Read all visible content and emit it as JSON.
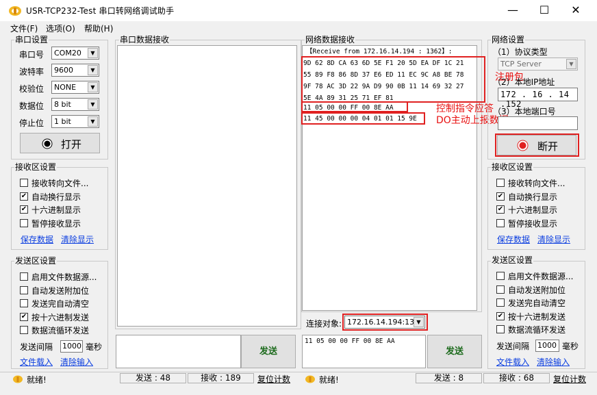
{
  "window": {
    "title": "USR-TCP232-Test 串口转网络调试助手",
    "min": "—",
    "max": "☐",
    "close": "✕"
  },
  "menu": [
    "文件(F)",
    "选项(O)",
    "帮助(H)"
  ],
  "serial_settings": {
    "title": "串口设置",
    "fields": [
      {
        "label": "串口号",
        "value": "COM20"
      },
      {
        "label": "波特率",
        "value": "9600"
      },
      {
        "label": "校验位",
        "value": "NONE"
      },
      {
        "label": "数据位",
        "value": "8 bit"
      },
      {
        "label": "停止位",
        "value": "1 bit"
      }
    ],
    "open_button": "打开"
  },
  "left_recv": {
    "title": "接收区设置",
    "options": [
      {
        "label": "接收转向文件...",
        "checked": false
      },
      {
        "label": "自动换行显示",
        "checked": true
      },
      {
        "label": "十六进制显示",
        "checked": true
      },
      {
        "label": "暂停接收显示",
        "checked": false
      }
    ],
    "save": "保存数据",
    "clear": "清除显示"
  },
  "left_send": {
    "title": "发送区设置",
    "options": [
      {
        "label": "启用文件数据源...",
        "checked": false
      },
      {
        "label": "自动发送附加位",
        "checked": false
      },
      {
        "label": "发送完自动清空",
        "checked": false
      },
      {
        "label": "按十六进制发送",
        "checked": true
      },
      {
        "label": "数据流循环发送",
        "checked": false
      }
    ],
    "interval_label": "发送间隔",
    "interval_value": "1000",
    "interval_unit": "毫秒",
    "load": "文件载入",
    "clear": "清除输入"
  },
  "serial_recv": {
    "title": "串口数据接收"
  },
  "serial_send": {
    "button": "发送"
  },
  "net_recv": {
    "title": "网络数据接收",
    "lines": [
      "【Receive from 172.16.14.194 : 1362】:",
      "9D 62 8D CA 63 6D 5E F1 20 5D EA DF 1C 21",
      "55 89 F8 86 8D 37 E6 ED 11 EC 9C A8 BE 78",
      "9F 78 AC 3D 22 9A D9 90 0B 11 14 69 32 27",
      "5E 4A 89 31 25 71 EF 81",
      "11 05 00 00 FF 00 8E AA",
      "11 45 00 00 00 04 01 01 15 9E"
    ],
    "annotations": [
      "注册包",
      "控制指令应答",
      "DO主动上报数据"
    ]
  },
  "connect": {
    "label": "连接对象:",
    "value": "172.16.14.194:1362"
  },
  "net_send": {
    "text": "11 05 00 00 FF 00 8E AA",
    "button": "发送"
  },
  "net_settings": {
    "title": "网络设置",
    "proto_label": "（1）协议类型",
    "proto_value": "TCP Server",
    "ip_label": "（2）本地IP地址",
    "ip_value": "172 . 16 . 14 .152",
    "port_label": "（3）本地端口号",
    "disconnect": "断开"
  },
  "right_recv": {
    "title": "接收区设置",
    "options": [
      {
        "label": "接收转向文件...",
        "checked": false
      },
      {
        "label": "自动换行显示",
        "checked": true
      },
      {
        "label": "十六进制显示",
        "checked": true
      },
      {
        "label": "暂停接收显示",
        "checked": false
      }
    ],
    "save": "保存数据",
    "clear": "清除显示"
  },
  "right_send": {
    "title": "发送区设置",
    "options": [
      {
        "label": "启用文件数据源...",
        "checked": false
      },
      {
        "label": "自动发送附加位",
        "checked": false
      },
      {
        "label": "发送完自动清空",
        "checked": false
      },
      {
        "label": "按十六进制发送",
        "checked": true
      },
      {
        "label": "数据流循环发送",
        "checked": false
      }
    ],
    "interval_label": "发送间隔",
    "interval_value": "1000",
    "interval_unit": "毫秒",
    "load": "文件载入",
    "clear": "清除输入"
  },
  "status_left": {
    "ready": "就绪!",
    "sent": "发送 : 48",
    "recv": "接收 : 189",
    "reset": "复位计数"
  },
  "status_right": {
    "ready": "就绪!",
    "sent": "发送 : 8",
    "recv": "接收 : 68",
    "reset": "复位计数"
  },
  "colors": {
    "annotation": "#e81010",
    "link": "#0b3ee0",
    "send_button_text": "#1d6b1d"
  }
}
